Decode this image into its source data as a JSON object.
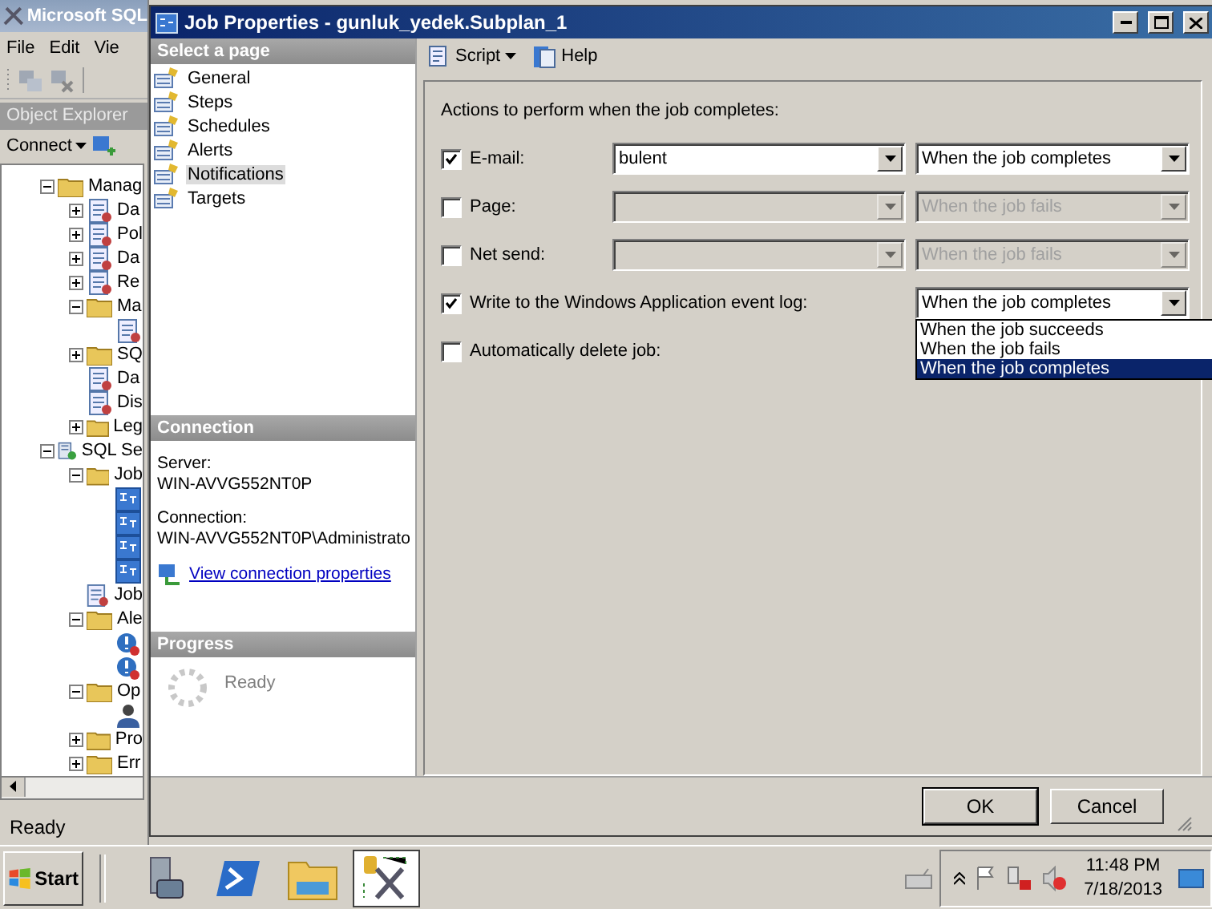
{
  "main_window": {
    "title": "Microsoft SQL",
    "menu": [
      "File",
      "Edit",
      "Vie"
    ],
    "explorer_title": "Object Explorer",
    "connect": "Connect",
    "status": "Ready",
    "tree": [
      {
        "label": "Manag",
        "kind": "folder",
        "expanded": true,
        "children": [
          {
            "label": "Da",
            "kind": "item",
            "expanded": false
          },
          {
            "label": "Pol",
            "kind": "item",
            "expanded": false
          },
          {
            "label": "Da",
            "kind": "item",
            "expanded": false
          },
          {
            "label": "Re",
            "kind": "item",
            "expanded": false
          },
          {
            "label": "Ma",
            "kind": "folder",
            "expanded": true,
            "children": [
              {
                "kind": "item"
              }
            ]
          },
          {
            "label": "SQ",
            "kind": "folder",
            "expanded": false
          },
          {
            "label": "Da",
            "kind": "item"
          },
          {
            "label": "Dis",
            "kind": "item"
          },
          {
            "label": "Leg",
            "kind": "folder",
            "expanded": false
          }
        ]
      },
      {
        "label": "SQL Se",
        "kind": "server",
        "expanded": true,
        "children": [
          {
            "label": "Job",
            "kind": "folder",
            "expanded": true,
            "children": [
              {
                "kind": "job"
              },
              {
                "kind": "job"
              },
              {
                "kind": "job"
              },
              {
                "kind": "job"
              }
            ]
          },
          {
            "label": "Job",
            "kind": "item"
          },
          {
            "label": "Ale",
            "kind": "folder",
            "expanded": true,
            "children": [
              {
                "kind": "alert"
              },
              {
                "kind": "alert"
              }
            ]
          },
          {
            "label": "Op",
            "kind": "folder",
            "expanded": true,
            "children": [
              {
                "kind": "operator"
              }
            ]
          },
          {
            "label": "Pro",
            "kind": "folder",
            "expanded": false
          },
          {
            "label": "Err",
            "kind": "folder",
            "expanded": false
          }
        ]
      }
    ]
  },
  "dialog": {
    "title": "Job Properties - gunluk_yedek.Subplan_1",
    "select_header": "Select a page",
    "pages": [
      {
        "label": "General",
        "selected": false
      },
      {
        "label": "Steps",
        "selected": false
      },
      {
        "label": "Schedules",
        "selected": false
      },
      {
        "label": "Alerts",
        "selected": false
      },
      {
        "label": "Notifications",
        "selected": true
      },
      {
        "label": "Targets",
        "selected": false
      }
    ],
    "connection_header": "Connection",
    "server_label": "Server:",
    "server": "WIN-AVVG552NT0P",
    "connection_label": "Connection:",
    "connection": "WIN-AVVG552NT0P\\Administrato",
    "connection_link": "View connection properties",
    "progress_header": "Progress",
    "progress": "Ready",
    "toolbar": [
      "Script",
      "Help"
    ],
    "heading": "Actions to perform when the job completes:",
    "actions": [
      {
        "kind": "notify",
        "label": "E-mail:",
        "checked": true,
        "recipient": "bulent",
        "when": "When the job completes",
        "disabled": false
      },
      {
        "kind": "notify",
        "label": "Page:",
        "checked": false,
        "when": "When the job fails",
        "disabled": true
      },
      {
        "kind": "notify",
        "label": "Net send:",
        "checked": false,
        "when": "When the job fails",
        "disabled": true
      },
      {
        "kind": "log",
        "label": "Write to the Windows Application event log:",
        "checked": true,
        "when": "When the job completes",
        "expanded": true,
        "options": [
          {
            "label": "When the job succeeds",
            "selected": false
          },
          {
            "label": "When the job fails",
            "selected": false
          },
          {
            "label": "When the job completes",
            "selected": true
          }
        ]
      },
      {
        "kind": "delete",
        "label": "Automatically delete job:",
        "checked": false
      }
    ],
    "buttons": [
      "OK",
      "Cancel"
    ]
  },
  "taskbar": {
    "start": "Start",
    "apps": [
      {
        "kind": "server",
        "selected": false
      },
      {
        "kind": "powershell",
        "selected": false
      },
      {
        "kind": "explorer",
        "selected": false
      },
      {
        "kind": "tools",
        "selected": true
      }
    ],
    "time": "11:48 PM",
    "date": "7/18/2013"
  }
}
